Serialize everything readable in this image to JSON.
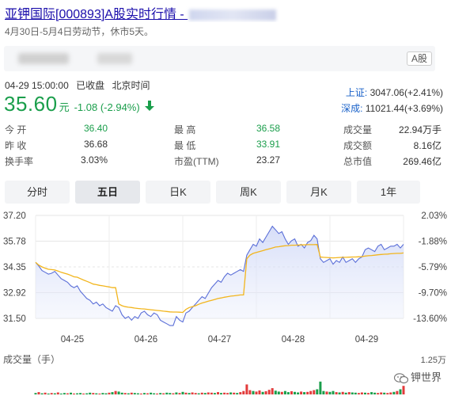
{
  "header": {
    "title_link": "亚钾国际[000893]A股实时行情 - ",
    "holiday_notice": "4月30日-5月4日劳动节，休市5天。"
  },
  "stock": {
    "market_badge": "A股",
    "timestamp": "04-29 15:00:00",
    "status": "已收盘",
    "timezone": "北京时间",
    "price": "35.60",
    "price_unit": "元",
    "change": "-1.08 (-2.94%)"
  },
  "indices": [
    {
      "name": "上证:",
      "value": "3047.06(+2.41%)"
    },
    {
      "name": "深成:",
      "value": "11021.44(+3.69%)"
    }
  ],
  "stats": {
    "open_label": "今 开",
    "open_value": "36.40",
    "prev_label": "昨 收",
    "prev_value": "36.68",
    "turnover_label": "换手率",
    "turnover_value": "3.03%",
    "high_label": "最 高",
    "high_value": "36.58",
    "low_label": "最 低",
    "low_value": "33.91",
    "pe_label": "市盈(TTM)",
    "pe_value": "23.27",
    "volume_label": "成交量",
    "volume_value": "22.94万手",
    "amount_label": "成交额",
    "amount_value": "8.16亿",
    "mktcap_label": "总市值",
    "mktcap_value": "269.46亿"
  },
  "tabs": [
    "分时",
    "五日",
    "日K",
    "周K",
    "月K",
    "1年"
  ],
  "active_tab": "五日",
  "colors": {
    "down": "#1a9e4b",
    "up": "#e23b3b",
    "price_line": "#5b6fd8",
    "avg_line": "#f2b51c",
    "link": "#1a0dab"
  },
  "chart_data": {
    "type": "line",
    "x_tick_labels": [
      "04-25",
      "04-26",
      "04-27",
      "04-28",
      "04-29"
    ],
    "y_tick_labels": [
      "37.20",
      "35.78",
      "34.35",
      "32.92",
      "31.50"
    ],
    "y_right_tick_labels": [
      "2.03%",
      "-1.88%",
      "-5.79%",
      "-9.70%",
      "-13.60%"
    ],
    "ylim": [
      31.5,
      37.2
    ],
    "volume_label": "成交量（手）",
    "volume_max_label": "1.25万",
    "series": [
      {
        "values": [
          34.6,
          34.4,
          34.15,
          34.05,
          33.95,
          34.0,
          34.1,
          33.9,
          33.7,
          33.6,
          33.5,
          33.3,
          33.2,
          33.3,
          33.0,
          32.8,
          32.6,
          32.5,
          32.3,
          32.4,
          32.2,
          32.3,
          32.1,
          32.0,
          31.9,
          32.2,
          32.1,
          31.7,
          31.5,
          31.6,
          31.4,
          31.6,
          31.5,
          31.8,
          31.9,
          31.7,
          31.6,
          31.8,
          31.7,
          31.4,
          31.3,
          31.2,
          31.1,
          31.1,
          31.6,
          31.4,
          31.3,
          31.8,
          31.9,
          32.1,
          32.3,
          32.5,
          32.7,
          32.6,
          32.9,
          33.2,
          33.4,
          33.6,
          33.5,
          33.8,
          34.0,
          33.9,
          34.0,
          34.1,
          34.2,
          34.1,
          35.0,
          35.3,
          35.6,
          35.5,
          35.9,
          35.7,
          36.0,
          36.3,
          36.6,
          36.4,
          36.2,
          36.3,
          35.9,
          35.6,
          35.8,
          35.9,
          35.5,
          35.6,
          35.4,
          35.7,
          35.8,
          36.1,
          35.9,
          34.8,
          34.6,
          34.7,
          34.8,
          34.5,
          34.7,
          34.6,
          34.9,
          34.6,
          34.7,
          34.8,
          34.6,
          34.8,
          34.9,
          35.3,
          35.4,
          35.3,
          35.2,
          35.5,
          35.6,
          35.3,
          35.4,
          35.5,
          35.5,
          35.6,
          35.4,
          35.6
        ]
      },
      {
        "values": [
          34.6,
          34.45,
          34.35,
          34.28,
          34.22,
          34.2,
          34.18,
          34.12,
          34.05,
          34.0,
          33.95,
          33.88,
          33.8,
          33.78,
          33.7,
          33.62,
          33.55,
          33.48,
          33.4,
          33.37,
          33.33,
          33.3,
          33.27,
          33.24,
          33.2,
          33.2,
          32.3,
          32.2,
          32.15,
          32.12,
          32.1,
          32.07,
          32.05,
          32.03,
          32.02,
          32.0,
          31.98,
          31.96,
          31.94,
          31.92,
          31.9,
          31.88,
          31.86,
          31.85,
          31.85,
          31.84,
          31.83,
          32.0,
          32.1,
          32.15,
          32.2,
          32.28,
          32.35,
          32.4,
          32.45,
          32.5,
          32.55,
          32.6,
          32.63,
          32.67,
          32.7,
          32.73,
          32.75,
          32.77,
          32.8,
          32.8,
          34.8,
          35.0,
          35.1,
          35.15,
          35.2,
          35.25,
          35.3,
          35.35,
          35.4,
          35.45,
          35.47,
          35.5,
          35.52,
          35.53,
          35.55,
          35.55,
          35.56,
          35.57,
          35.57,
          35.58,
          35.58,
          35.58,
          35.59,
          34.9,
          34.88,
          34.87,
          34.86,
          34.85,
          34.86,
          34.87,
          34.88,
          34.88,
          34.89,
          34.9,
          34.9,
          34.91,
          34.92,
          34.95,
          34.97,
          34.98,
          35.0,
          35.02,
          35.04,
          35.05,
          35.06,
          35.08,
          35.09,
          35.1,
          35.1,
          35.12
        ]
      }
    ],
    "volume": [
      0.05,
      0.08,
      0.04,
      0.06,
      0.03,
      0.05,
      0.04,
      0.07,
      0.03,
      0.05,
      0.04,
      0.06,
      0.03,
      0.04,
      0.05,
      0.03,
      0.04,
      0.06,
      0.05,
      0.04,
      0.03,
      0.05,
      0.04,
      0.06,
      0.08,
      0.12,
      0.1,
      0.06,
      0.05,
      0.04,
      0.06,
      0.05,
      0.04,
      0.03,
      0.05,
      0.04,
      0.06,
      0.04,
      0.03,
      0.05,
      0.04,
      0.06,
      0.05,
      0.04,
      0.07,
      0.05,
      0.09,
      0.06,
      0.05,
      0.07,
      0.05,
      0.04,
      0.06,
      0.05,
      0.07,
      0.06,
      0.05,
      0.08,
      0.05,
      0.06,
      0.05,
      0.07,
      0.06,
      0.05,
      0.08,
      0.12,
      0.35,
      0.15,
      0.12,
      0.1,
      0.14,
      0.09,
      0.11,
      0.16,
      0.22,
      0.13,
      0.1,
      0.09,
      0.12,
      0.08,
      0.11,
      0.09,
      0.07,
      0.1,
      0.08,
      0.09,
      0.12,
      0.15,
      0.18,
      0.45,
      0.12,
      0.1,
      0.09,
      0.12,
      0.08,
      0.07,
      0.09,
      0.06,
      0.08,
      0.07,
      0.06,
      0.05,
      0.07,
      0.06,
      0.05,
      0.08,
      0.06,
      0.05,
      0.07,
      0.06,
      0.05,
      0.07,
      0.09,
      0.12,
      0.18,
      0.3
    ],
    "volume_up": [
      0,
      1,
      0,
      1,
      0,
      1,
      0,
      1,
      0,
      0,
      1,
      0,
      1,
      0,
      0,
      1,
      0,
      0,
      1,
      0,
      1,
      0,
      0,
      1,
      0,
      1,
      0,
      0,
      1,
      0,
      1,
      0,
      0,
      1,
      0,
      1,
      0,
      0,
      1,
      0,
      1,
      0,
      0,
      1,
      0,
      1,
      0,
      1,
      0,
      1,
      1,
      0,
      1,
      0,
      1,
      1,
      0,
      1,
      0,
      1,
      1,
      0,
      1,
      0,
      1,
      1,
      1,
      1,
      0,
      1,
      1,
      0,
      1,
      1,
      1,
      0,
      0,
      1,
      0,
      0,
      1,
      0,
      0,
      1,
      0,
      1,
      1,
      1,
      0,
      0,
      0,
      1,
      0,
      0,
      1,
      0,
      1,
      0,
      1,
      0,
      0,
      1,
      1,
      0,
      1,
      0,
      0,
      1,
      1,
      0,
      1,
      1,
      0,
      1,
      0,
      1
    ]
  },
  "watermark": "钾世界"
}
